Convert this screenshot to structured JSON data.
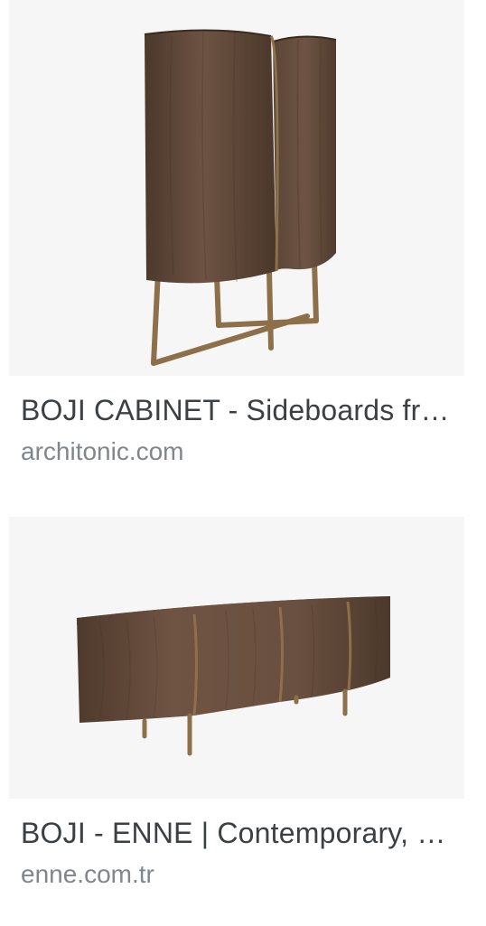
{
  "results": [
    {
      "title": "BOJI CABINET - Sideboards from ENNE | Architonic",
      "domain": "architonic.com",
      "image_alt": "Boji cabinet"
    },
    {
      "title": "BOJI - ENNE | Contemporary, Luxury Furniture",
      "domain": "enne.com.tr",
      "image_alt": "Boji sideboard"
    }
  ],
  "colors": {
    "wood_dark": "#4e3b2e",
    "wood_mid": "#6b5140",
    "brass": "#9a7b52",
    "thumb_bg": "#f6f6f6"
  }
}
